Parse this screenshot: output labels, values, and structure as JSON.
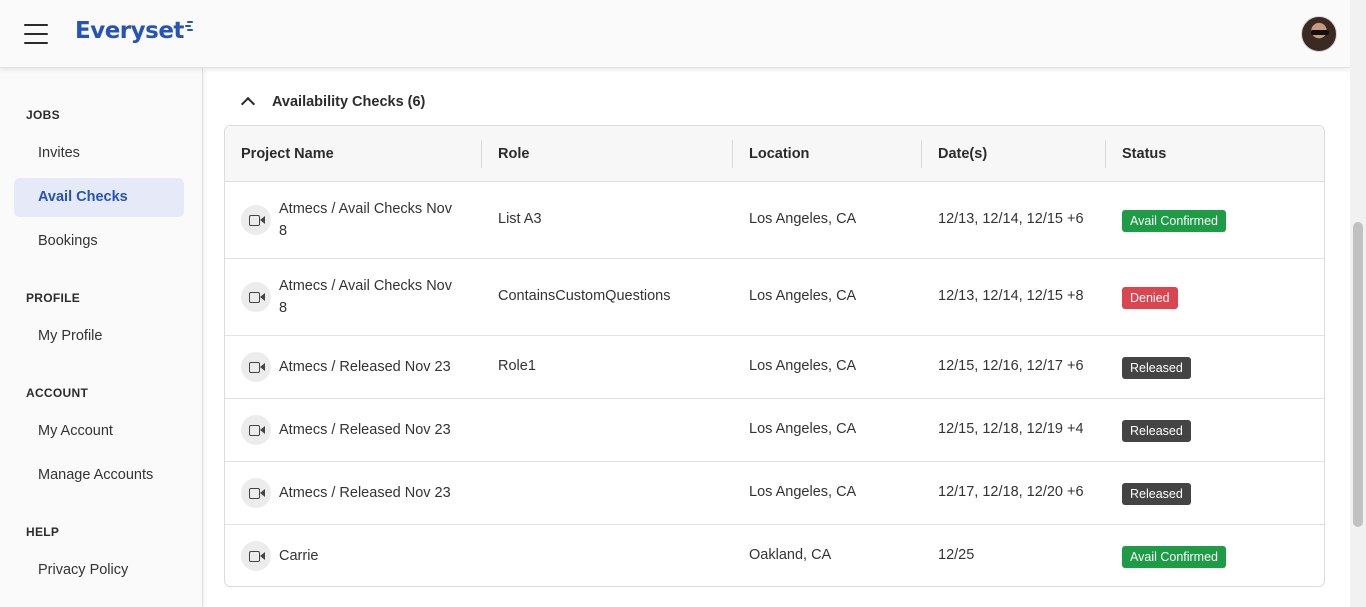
{
  "brand": {
    "name": "Everyset",
    "color": "#2553b8"
  },
  "header": {
    "menu_icon": "hamburger-icon",
    "avatar_icon": "user-avatar"
  },
  "sidebar": {
    "sections": [
      {
        "label": "JOBS",
        "items": [
          "Invites",
          "Avail Checks",
          "Bookings"
        ]
      },
      {
        "label": "PROFILE",
        "items": [
          "My Profile"
        ]
      },
      {
        "label": "ACCOUNT",
        "items": [
          "My Account",
          "Manage Accounts"
        ]
      },
      {
        "label": "HELP",
        "items": [
          "Privacy Policy"
        ]
      }
    ],
    "active_item": "Avail Checks"
  },
  "main": {
    "section_title": "Availability Checks (6)",
    "columns": [
      "Project Name",
      "Role",
      "Location",
      "Date(s)",
      "Status"
    ],
    "rows": [
      {
        "project": "Atmecs / Avail Checks Nov 8",
        "role": "List A3",
        "location": "Los Angeles, CA",
        "dates": "12/13, 12/14, 12/15 +6",
        "status": "Avail Confirmed",
        "status_color": "#1e9b45"
      },
      {
        "project": "Atmecs / Avail Checks Nov 8",
        "role": "ContainsCustomQuestions",
        "location": "Los Angeles, CA",
        "dates": "12/13, 12/14, 12/15 +8",
        "status": "Denied",
        "status_color": "#dc4550"
      },
      {
        "project": "Atmecs / Released Nov 23",
        "role": "Role1",
        "location": "Los Angeles, CA",
        "dates": "12/15, 12/16, 12/17 +6",
        "status": "Released",
        "status_color": "#444444"
      },
      {
        "project": "Atmecs / Released Nov 23",
        "role": "",
        "location": "Los Angeles, CA",
        "dates": "12/15, 12/18, 12/19 +4",
        "status": "Released",
        "status_color": "#444444"
      },
      {
        "project": "Atmecs / Released Nov 23",
        "role": "",
        "location": "Los Angeles, CA",
        "dates": "12/17, 12/18, 12/20 +6",
        "status": "Released",
        "status_color": "#444444"
      },
      {
        "project": "Carrie",
        "role": "",
        "location": "Oakland, CA",
        "dates": "12/25",
        "status": "Avail Confirmed",
        "status_color": "#1e9b45"
      }
    ]
  }
}
